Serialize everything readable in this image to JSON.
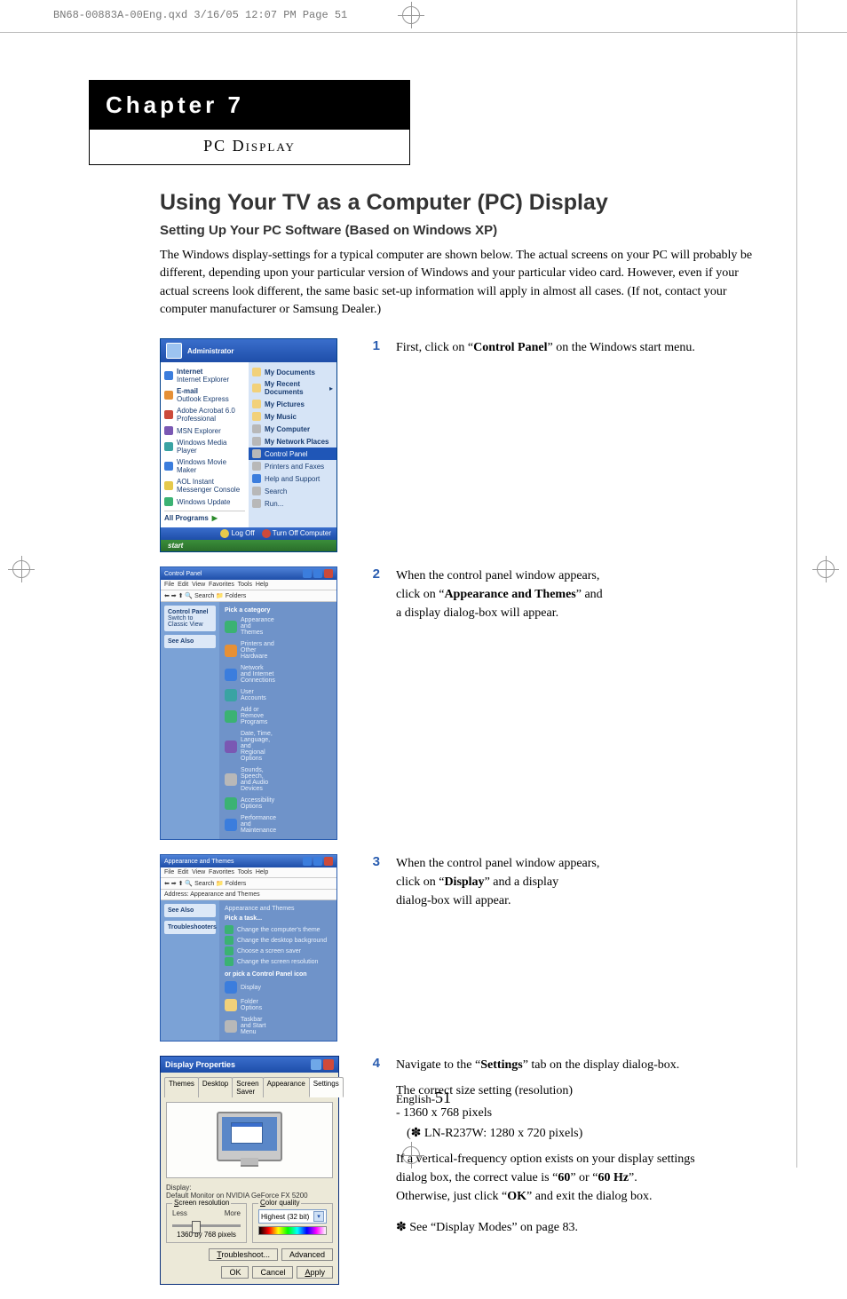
{
  "print_header": "BN68-00883A-00Eng.qxd  3/16/05 12:07 PM  Page 51",
  "chapter": {
    "title": "Chapter 7",
    "subtitle": "PC Display"
  },
  "headings": {
    "h1": "Using Your TV as a Computer (PC) Display",
    "h2": "Setting Up Your PC Software (Based on Windows XP)"
  },
  "intro": "The Windows display-settings for a typical computer are shown below. The actual screens on your PC will probably be different, depending upon your particular version of Windows and your particular video card. However, even if your actual screens look different, the same basic set-up information will apply in almost all cases. (If not, contact your computer manufacturer or Samsung Dealer.)",
  "steps": {
    "s1": {
      "num": "1",
      "pre": "First, click on ",
      "bold": "Control Panel",
      "post": " on the Windows start menu."
    },
    "s2": {
      "num": "2",
      "line1": "When the control panel window appears,",
      "pre": "click on ",
      "bold": "Appearance and Themes",
      "post": " and",
      "line3": "a display dialog-box will appear."
    },
    "s3": {
      "num": "3",
      "line1": "When the control panel window appears,",
      "pre": "click on ",
      "bold": "Display",
      "post": " and a display",
      "line3": "dialog-box will appear."
    },
    "s4": {
      "num": "4",
      "l1_pre": "Navigate to the ",
      "l1_bold": "Settings",
      "l1_post": " tab on the display dialog-box.",
      "l2": "The correct size setting (resolution)",
      "l3": "- 1360 x 768 pixels",
      "l4": "  (✽ LN-R237W: 1280 x 720 pixels)",
      "l5_a": "If a vertical-frequency option exists on your display settings dialog box, the correct value is ",
      "l5_b1": "60",
      "l5_mid": " or ",
      "l5_b2": "60 Hz",
      "l5_c": ".",
      "l6_a": "Otherwise, just click ",
      "l6_bold": "OK",
      "l6_b": " and exit the dialog box.",
      "l7": "✽ See “Display Modes” on page 83."
    }
  },
  "startmenu": {
    "user": "Administrator",
    "left": [
      {
        "label": "Internet",
        "sub": "Internet Explorer"
      },
      {
        "label": "E-mail",
        "sub": "Outlook Express"
      },
      {
        "label": "Adobe Acrobat 6.0 Professional"
      },
      {
        "label": "MSN Explorer"
      },
      {
        "label": "Windows Media Player"
      },
      {
        "label": "Windows Movie Maker"
      },
      {
        "label": "AOL Instant Messenger Console"
      },
      {
        "label": "Windows Update"
      }
    ],
    "all_programs": "All Programs",
    "right": [
      "My Documents",
      "My Recent Documents",
      "My Pictures",
      "My Music",
      "My Computer",
      "My Network Places",
      "Control Panel",
      "Printers and Faxes",
      "Help and Support",
      "Search",
      "Run..."
    ],
    "highlight_index": 6,
    "logoff": "Log Off",
    "turnoff": "Turn Off Computer",
    "start": "start"
  },
  "cp_window": {
    "title": "Control Panel",
    "pick": "Pick a category",
    "cats": [
      "Appearance and Themes",
      "Printers and Other Hardware",
      "Network and Internet Connections",
      "User Accounts",
      "Add or Remove Programs",
      "Date, Time, Language, and Regional Options",
      "Sounds, Speech, and Audio Devices",
      "Accessibility Options",
      "Performance and Maintenance"
    ],
    "side_switch": "Switch to Classic View",
    "side_see": "See Also"
  },
  "at_window": {
    "title": "Appearance and Themes",
    "crumb": "Appearance and Themes",
    "pick_task": "Pick a task...",
    "tasks": [
      "Change the computer's theme",
      "Change the desktop background",
      "Choose a screen saver",
      "Change the screen resolution"
    ],
    "or_pick": "or pick a Control Panel icon",
    "icons": [
      "Display",
      "Folder Options",
      "Taskbar and Start Menu"
    ],
    "side_see": "See Also",
    "side_ts": "Troubleshooters"
  },
  "dp_dialog": {
    "title": "Display Properties",
    "tabs": [
      "Themes",
      "Desktop",
      "Screen Saver",
      "Appearance",
      "Settings"
    ],
    "active_tab": 4,
    "display_label": "Display:",
    "display_value": "Default Monitor on NVIDIA GeForce FX 5200",
    "res_legend": "Screen resolution",
    "res_less": "Less",
    "res_more": "More",
    "res_current": "1360 by 768 pixels",
    "cq_legend": "Color quality",
    "cq_value": "Highest (32 bit)",
    "btn_ts": "Troubleshoot...",
    "btn_adv": "Advanced",
    "btn_ok": "OK",
    "btn_cancel": "Cancel",
    "btn_apply": "Apply"
  },
  "footer": {
    "lang": "English-",
    "page": "51"
  }
}
